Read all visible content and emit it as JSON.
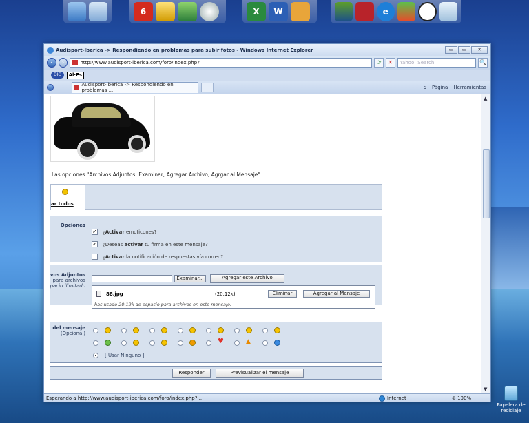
{
  "window": {
    "title": "Audisport-Iberica -> Respondiendo en problemas para subir fotos - Windows Internet Explorer",
    "controls": {
      "minimize": "▭",
      "maximize": "▭",
      "close": "✕"
    }
  },
  "address_bar": {
    "url": "http://www.audisport-iberica.com/foro/index.php?",
    "search_placeholder": "Yahoo! Search",
    "go_icon": "⟳",
    "stop_icon": "✕",
    "search_icon": "🔍"
  },
  "toolbar2": {
    "pill_label": "DIC",
    "dropdown_label": "Al·Es"
  },
  "tab": {
    "title": "Audisport-Iberica -> Respondiendo en problemas ..."
  },
  "command_bar": {
    "page_label": "Página",
    "tools_label": "Herramientas"
  },
  "content": {
    "intro_text": "Las opciones \"Archivos Adjuntos, Examinar, Agregar Archivo, Agrgar al Mensaje\"",
    "emoticons_tab_label": "ar todos",
    "options": {
      "label": "Opciones",
      "items": [
        {
          "bold": "Activar",
          "text": " emoticones?",
          "checked": true
        },
        {
          "prefix": "¿Deseas ",
          "bold": "activar",
          "text": " tu firma en este mensaje?",
          "checked": true
        },
        {
          "bold": "Activar",
          "text": " la notificación de respuestas vía correo?",
          "checked": false
        }
      ]
    },
    "attachments": {
      "label_line1": "vos Adjuntos",
      "label_line2": "para archivos",
      "label_line3": "pacio ilimitado",
      "browse_button": "Examinar...",
      "add_file_button": "Agregar este Archivo",
      "file_name": "88.jpg",
      "file_size": "(20.12k)",
      "delete_button": "Eliminar",
      "add_to_post_button": "Agregar al Mensaje",
      "usage_note": "has usado 20.12k de espacio para archivos en este mensaje."
    },
    "post_icon": {
      "label_line1": "del mensaje",
      "label_line2": "(Opcional)",
      "none_label": "[ Usar Ninguno ]"
    },
    "buttons": {
      "reply": "Responder",
      "preview": "Previsualizar el mensaje"
    }
  },
  "status": {
    "text": "Esperando a http://www.audisport-iberica.com/foro/index.php?...",
    "zone": "Internet",
    "zoom": "100%"
  },
  "desktop": {
    "recycle_bin_label": "Papelera de reciclaje"
  }
}
